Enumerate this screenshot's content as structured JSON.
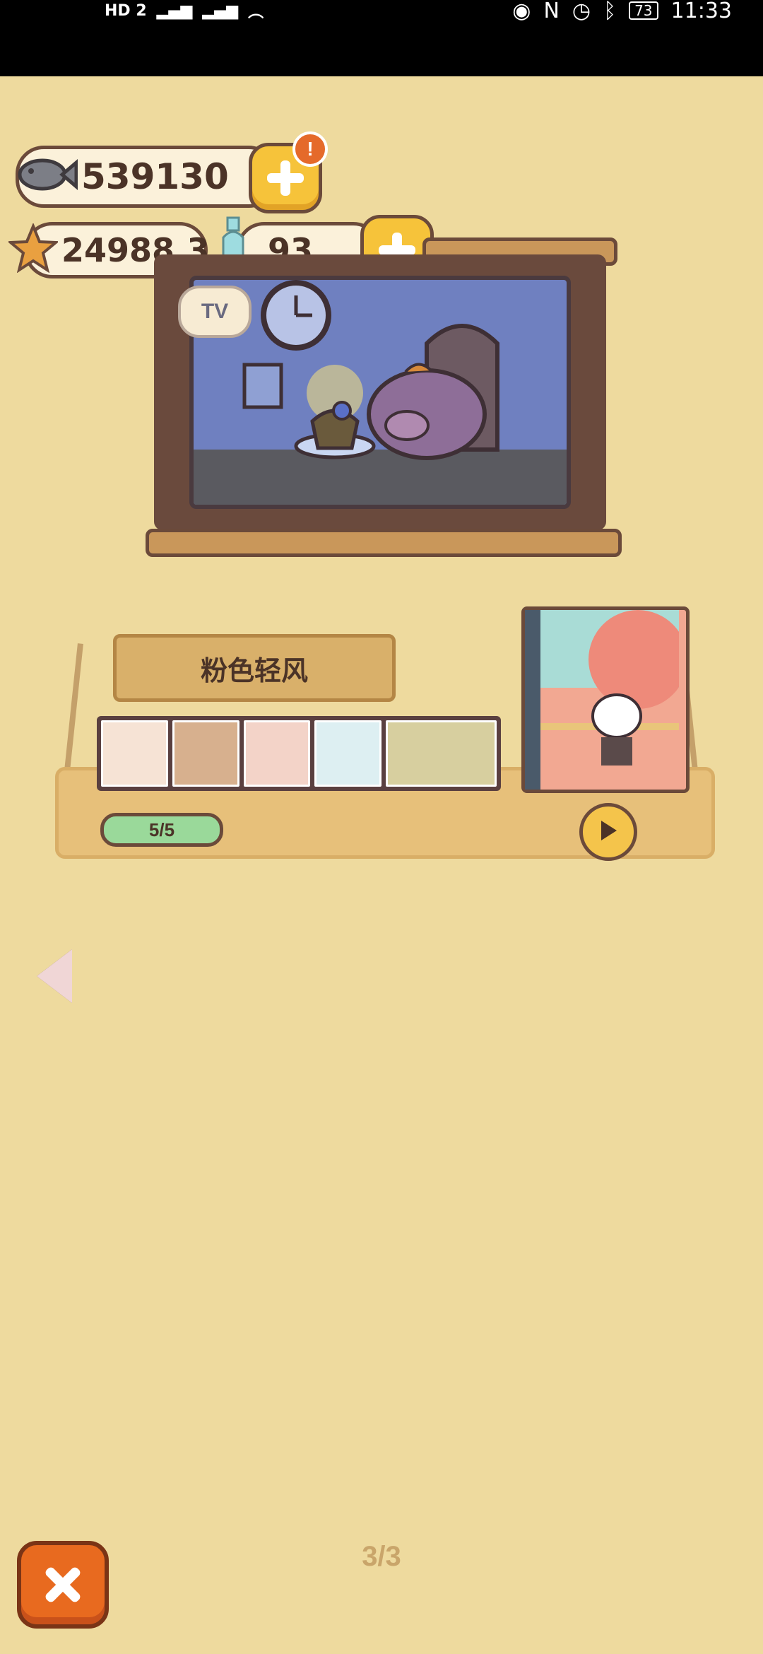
{
  "status_bar": {
    "left": "HD 2",
    "time": "11:33",
    "battery": "73"
  },
  "currency": {
    "fish": "539130",
    "stars": "24988.3",
    "bottles": "93",
    "badge": "!"
  },
  "tv": {
    "logo": "TV"
  },
  "shelf": {
    "title": "粉色轻风",
    "progress": "5/5"
  },
  "pager": {
    "indicator": "3/3"
  },
  "colors": {
    "background": "#EEDA9E",
    "accent_orange": "#E86A1F",
    "button_yellow": "#F6C33A"
  }
}
